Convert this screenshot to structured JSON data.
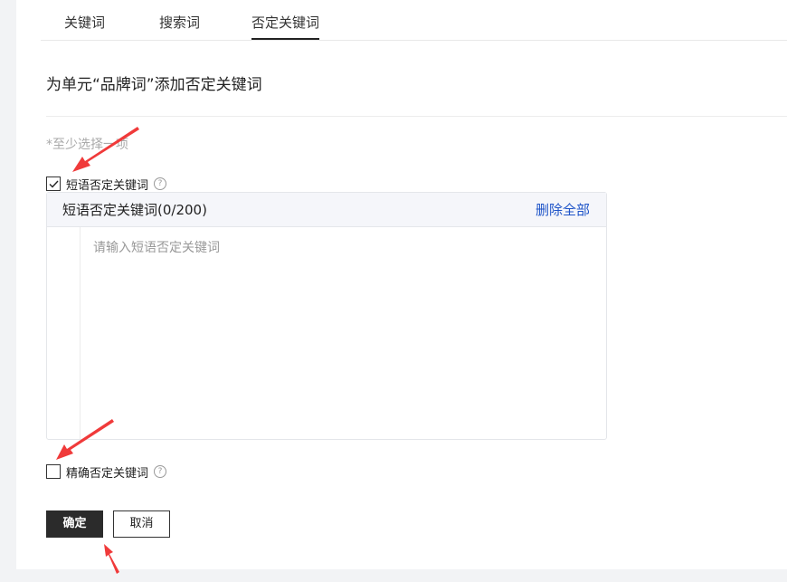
{
  "tabs": [
    {
      "label": "关键词"
    },
    {
      "label": "搜索词"
    },
    {
      "label": "否定关键词"
    }
  ],
  "active_tab": "否定关键词",
  "title": "为单元“品牌词”添加否定关键词",
  "hint": "*至少选择一项",
  "phrase_option": {
    "label": "短语否定关键词",
    "checked": true
  },
  "exact_option": {
    "label": "精确否定关键词",
    "checked": false
  },
  "help_icon": "question-circle-icon",
  "keyword_box": {
    "header": "短语否定关键词(0/200)",
    "clear_all": "删除全部",
    "placeholder": "请输入短语否定关键词",
    "value": ""
  },
  "buttons": {
    "confirm": "确定",
    "cancel": "取消"
  },
  "colors": {
    "accent_link": "#1e54c8",
    "primary_button": "#2b2b2b",
    "annotation_arrow": "#f03a3a"
  }
}
